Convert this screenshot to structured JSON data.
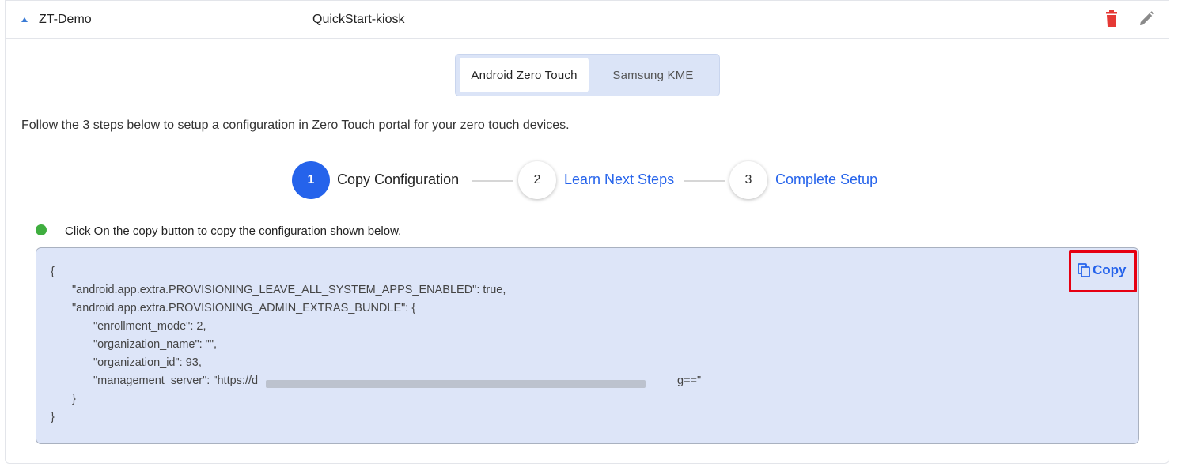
{
  "row": {
    "name": "ZT-Demo",
    "profile": "QuickStart-kiosk",
    "delete_icon": "trash-icon",
    "edit_icon": "pencil-icon",
    "expand_icon": "caret-up-icon"
  },
  "tabs": [
    {
      "label": "Android Zero Touch",
      "active": true
    },
    {
      "label": "Samsung KME",
      "active": false
    }
  ],
  "intro_text": "Follow the 3 steps below to setup a configuration in Zero Touch portal for your zero touch devices.",
  "steps": [
    {
      "number": "1",
      "label": "Copy Configuration",
      "active": true
    },
    {
      "number": "2",
      "label": "Learn Next Steps",
      "active": false
    },
    {
      "number": "3",
      "label": "Complete Setup",
      "active": false
    }
  ],
  "hint_text": "Click On the copy button to copy the configuration shown below.",
  "copy_label": "Copy",
  "code_lines": [
    "{",
    "\"android.app.extra.PROVISIONING_LEAVE_ALL_SYSTEM_APPS_ENABLED\": true,",
    "\"android.app.extra.PROVISIONING_ADMIN_EXTRAS_BUNDLE\": {",
    "\"enrollment_mode\": 2,",
    "\"organization_name\": \"\",",
    "\"organization_id\": 93,",
    "\"management_server\": \"https://d",
    "g==\"",
    "}",
    "}"
  ],
  "colors": {
    "accent": "#2563eb",
    "status": "#3fae3f",
    "delete": "#e53935",
    "highlight": "#e60012",
    "code_bg": "#dde5f8"
  }
}
